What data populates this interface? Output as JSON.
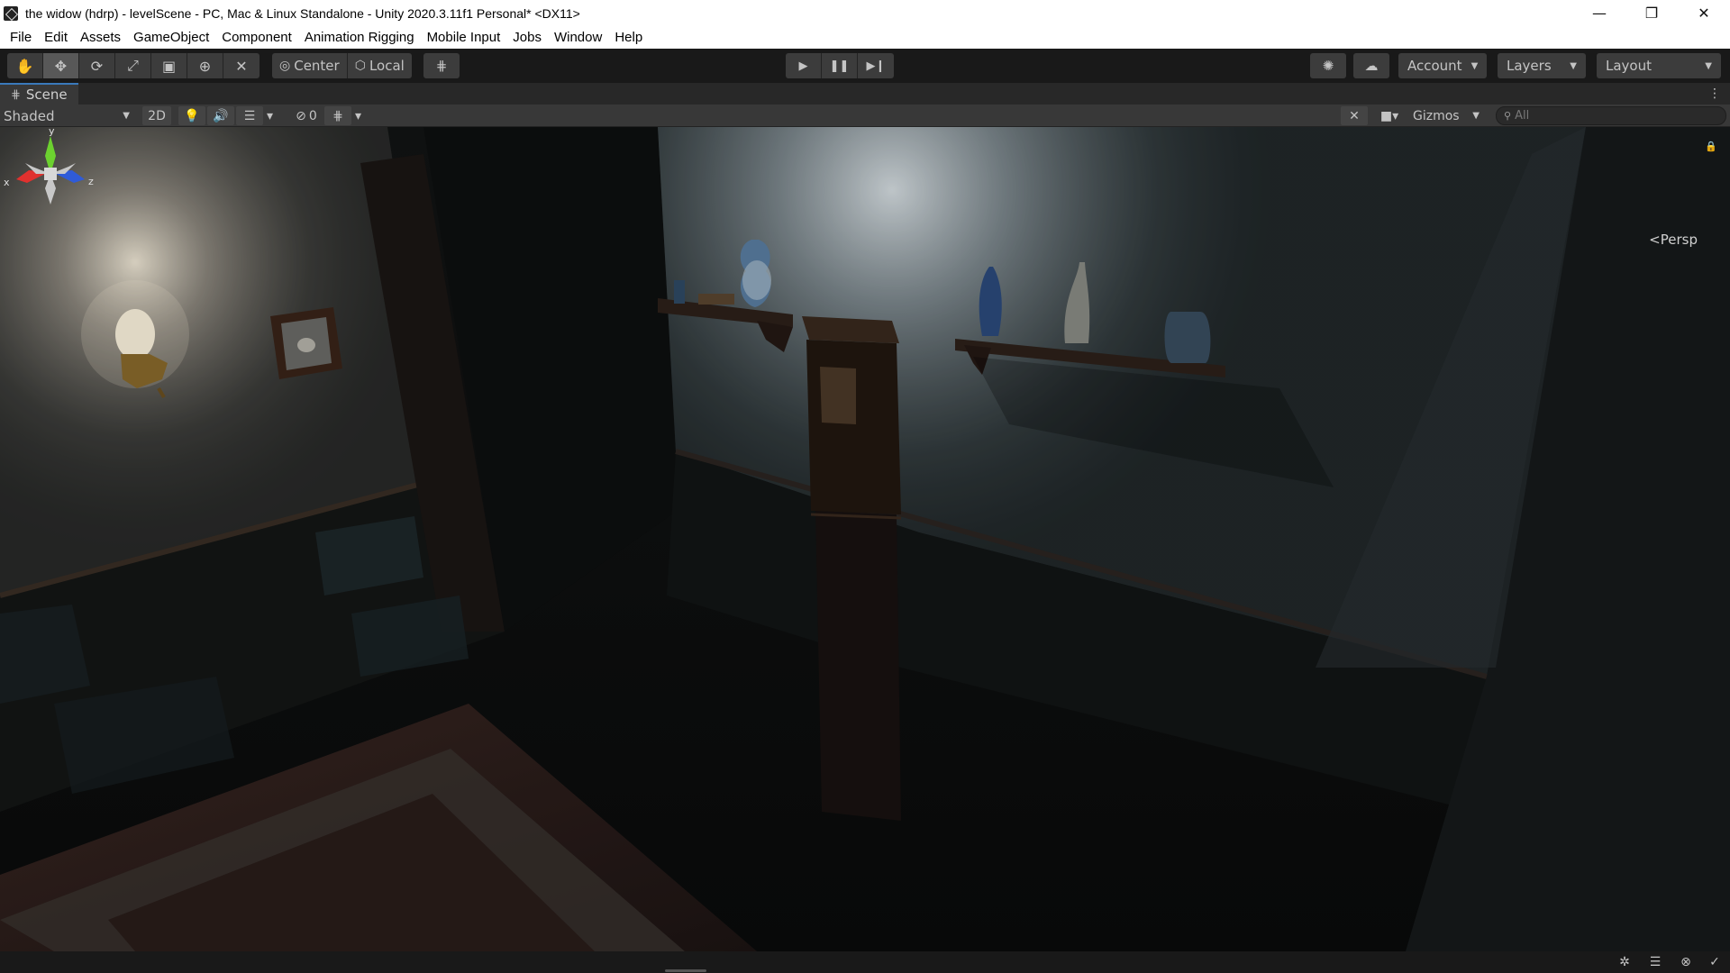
{
  "window": {
    "title": "the widow (hdrp) - levelScene - PC, Mac & Linux Standalone - Unity 2020.3.11f1 Personal* <DX11>",
    "controls": {
      "minimize": "—",
      "restore": "❐",
      "close": "✕"
    }
  },
  "menu": {
    "items": [
      "File",
      "Edit",
      "Assets",
      "GameObject",
      "Component",
      "Animation Rigging",
      "Mobile Input",
      "Jobs",
      "Window",
      "Help"
    ]
  },
  "toolbar": {
    "tools": [
      "hand-tool-icon",
      "move-tool-icon",
      "rotate-tool-icon",
      "scale-tool-icon",
      "rect-tool-icon",
      "transform-tool-icon",
      "custom-tool-icon"
    ],
    "active_tool": "move-tool-icon",
    "pivot_mode": "Center",
    "pivot_rotation": "Local",
    "account_label": "Account",
    "layers_label": "Layers",
    "layout_label": "Layout"
  },
  "scene": {
    "tab_label": "Scene",
    "draw_mode": "Shaded",
    "mode_2d": "2D",
    "hidden_count": "0",
    "gizmos_label": "Gizmos",
    "search_placeholder": "All",
    "projection_label": "Persp",
    "axis_labels": {
      "x": "x",
      "y": "y",
      "z": "z"
    }
  },
  "colors": {
    "accent": "#3a79bb",
    "axis_x": "#e0312e",
    "axis_y": "#6cd12f",
    "axis_z": "#2f5bd8"
  }
}
